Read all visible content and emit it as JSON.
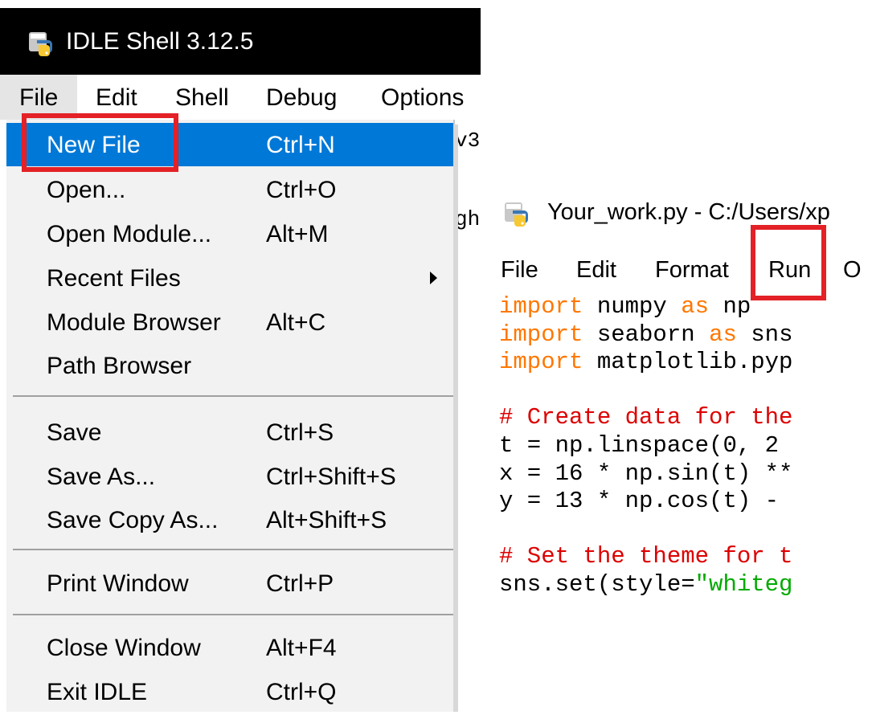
{
  "shell": {
    "title": "IDLE Shell 3.12.5",
    "menu": [
      "File",
      "Edit",
      "Shell",
      "Debug",
      "Options"
    ],
    "background_fragments": [
      "v3",
      "gh"
    ]
  },
  "file_menu": {
    "items": [
      {
        "label": "New File",
        "shortcut": "Ctrl+N"
      },
      {
        "label": "Open...",
        "shortcut": "Ctrl+O"
      },
      {
        "label": "Open Module...",
        "shortcut": "Alt+M"
      },
      {
        "label": "Recent Files",
        "shortcut": ""
      },
      {
        "label": "Module Browser",
        "shortcut": "Alt+C"
      },
      {
        "label": "Path Browser",
        "shortcut": ""
      },
      {
        "label": "Save",
        "shortcut": "Ctrl+S"
      },
      {
        "label": "Save As...",
        "shortcut": "Ctrl+Shift+S"
      },
      {
        "label": "Save Copy As...",
        "shortcut": "Alt+Shift+S"
      },
      {
        "label": "Print Window",
        "shortcut": "Ctrl+P"
      },
      {
        "label": "Close Window",
        "shortcut": "Alt+F4"
      },
      {
        "label": "Exit IDLE",
        "shortcut": "Ctrl+Q"
      }
    ],
    "highlighted": "New File"
  },
  "editor": {
    "title": "Your_work.py - C:/Users/xp",
    "menu": [
      "File",
      "Edit",
      "Format",
      "Run",
      "O"
    ],
    "code_lines": [
      {
        "kw": "import",
        "rest": " numpy ",
        "kw2": "as",
        "rest2": " np"
      },
      {
        "kw": "import",
        "rest": " seaborn ",
        "kw2": "as",
        "rest2": " sns"
      },
      {
        "kw": "import",
        "rest": " matplotlib.pyp",
        "kw2": "",
        "rest2": ""
      },
      {
        "plain": ""
      },
      {
        "comment": "# Create data for the"
      },
      {
        "plain": "t = np.linspace(0, 2"
      },
      {
        "plain": "x = 16 * np.sin(t) **"
      },
      {
        "plain": "y = 13 * np.cos(t) -"
      },
      {
        "plain": ""
      },
      {
        "comment": "# Set the theme for t"
      },
      {
        "plain": "sns.set(style=",
        "string": "\"whiteg"
      }
    ]
  },
  "colors": {
    "highlight": "#0078d7",
    "annotation_red": "#e32126",
    "keyword": "#ff7700",
    "comment": "#dd0000",
    "string": "#00aa00"
  },
  "icons": [
    "python-logo-icon",
    "submenu-arrow-icon"
  ]
}
